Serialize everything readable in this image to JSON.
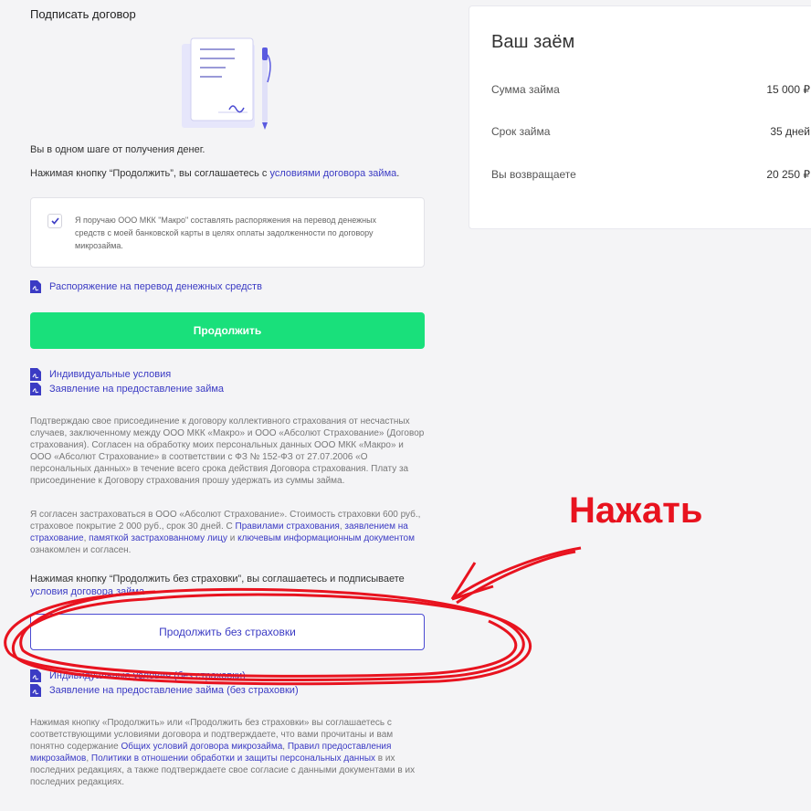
{
  "page": {
    "title": "Подписать договор",
    "one_step": "Вы в одном шаге от получения денег.",
    "consent_prefix": "Нажимая кнопку “Продолжить”, вы соглашаетесь с ",
    "consent_link": "условиями договора займа",
    "consent_suffix": "."
  },
  "agreement": {
    "checked": true,
    "text": "Я поручаю ООО МКК \"Макро\" составлять распоряжения на перевод денежных средств с моей банковской карты в целях оплаты задолженности по договору микрозайма."
  },
  "doc_transfer": "Распоряжение на перевод денежных средств",
  "continue_button": "Продолжить",
  "docs": [
    "Индивидуальные условия",
    "Заявление на предоставление займа"
  ],
  "insurance": {
    "paragraph1": "Подтверждаю свое присоединение к договору коллективного страхования от несчастных случаев, заключенному между ООО МКК «Макро» и ООО «Абсолют Страхование» (Договор страхования). Согласен на обработку моих персональных данных ООО МКК «Макро» и ООО «Абсолют Страхование» в соответствии с ФЗ № 152-ФЗ от 27.07.2006 «О персональных данных» в течение всего срока действия Договора страхования. Плату за присоединение к Договору страхования прошу удержать из суммы займа.",
    "p2_start": "Я согласен застраховаться в ООО «Абсолют Страхование». Стоимость страховки 600 руб., страховое покрытие 2 000 руб., срок 30 дней. С ",
    "p2_link1": "Правилами страхования",
    "p2_sep1": ", ",
    "p2_link2": "заявлением на страхование",
    "p2_sep2": ", ",
    "p2_link3": "памяткой застрахованному лицу",
    "p2_sep3": " и ",
    "p2_link4": "ключевым информационным документом",
    "p2_end": " ознакомлен и согласен."
  },
  "no_insurance": {
    "consent_prefix": "Нажимая кнопку “Продолжить без страховки”, вы соглашаетесь и подписываете ",
    "consent_link": "условия договора займа",
    "button": "Продолжить без страховки",
    "docs": [
      "Индивидуальные условия (без страховки)",
      "Заявление на предоставление займа (без страховки)"
    ]
  },
  "footer": {
    "start": "Нажимая кнопку «Продолжить» или «Продолжить без страховки» вы соглашаетесь с соответствующими условиями договора и подтверждаете, что вами прочитаны и вам понятно содержание ",
    "link1": "Общих условий договора микрозайма",
    "sep1": ", ",
    "link2": "Правил предоставления микрозаймов",
    "sep2": ", ",
    "link3": "Политики в отношении обработки и защиты персональных данных",
    "end": " в их последних редакциях, а также подтверждаете свое согласие с данными документами в их последних редакциях."
  },
  "loan_card": {
    "title": "Ваш заём",
    "rows": [
      {
        "label": "Сумма займа",
        "value": "15 000 ₽"
      },
      {
        "label": "Срок займа",
        "value": "35 дней"
      },
      {
        "label": "Вы возвращаете",
        "value": "20 250 ₽"
      }
    ]
  },
  "annotation": {
    "text": "Нажать",
    "color": "#e8131f"
  },
  "colors": {
    "accent_green": "#19e07b",
    "link_blue": "#3b3bc4"
  }
}
